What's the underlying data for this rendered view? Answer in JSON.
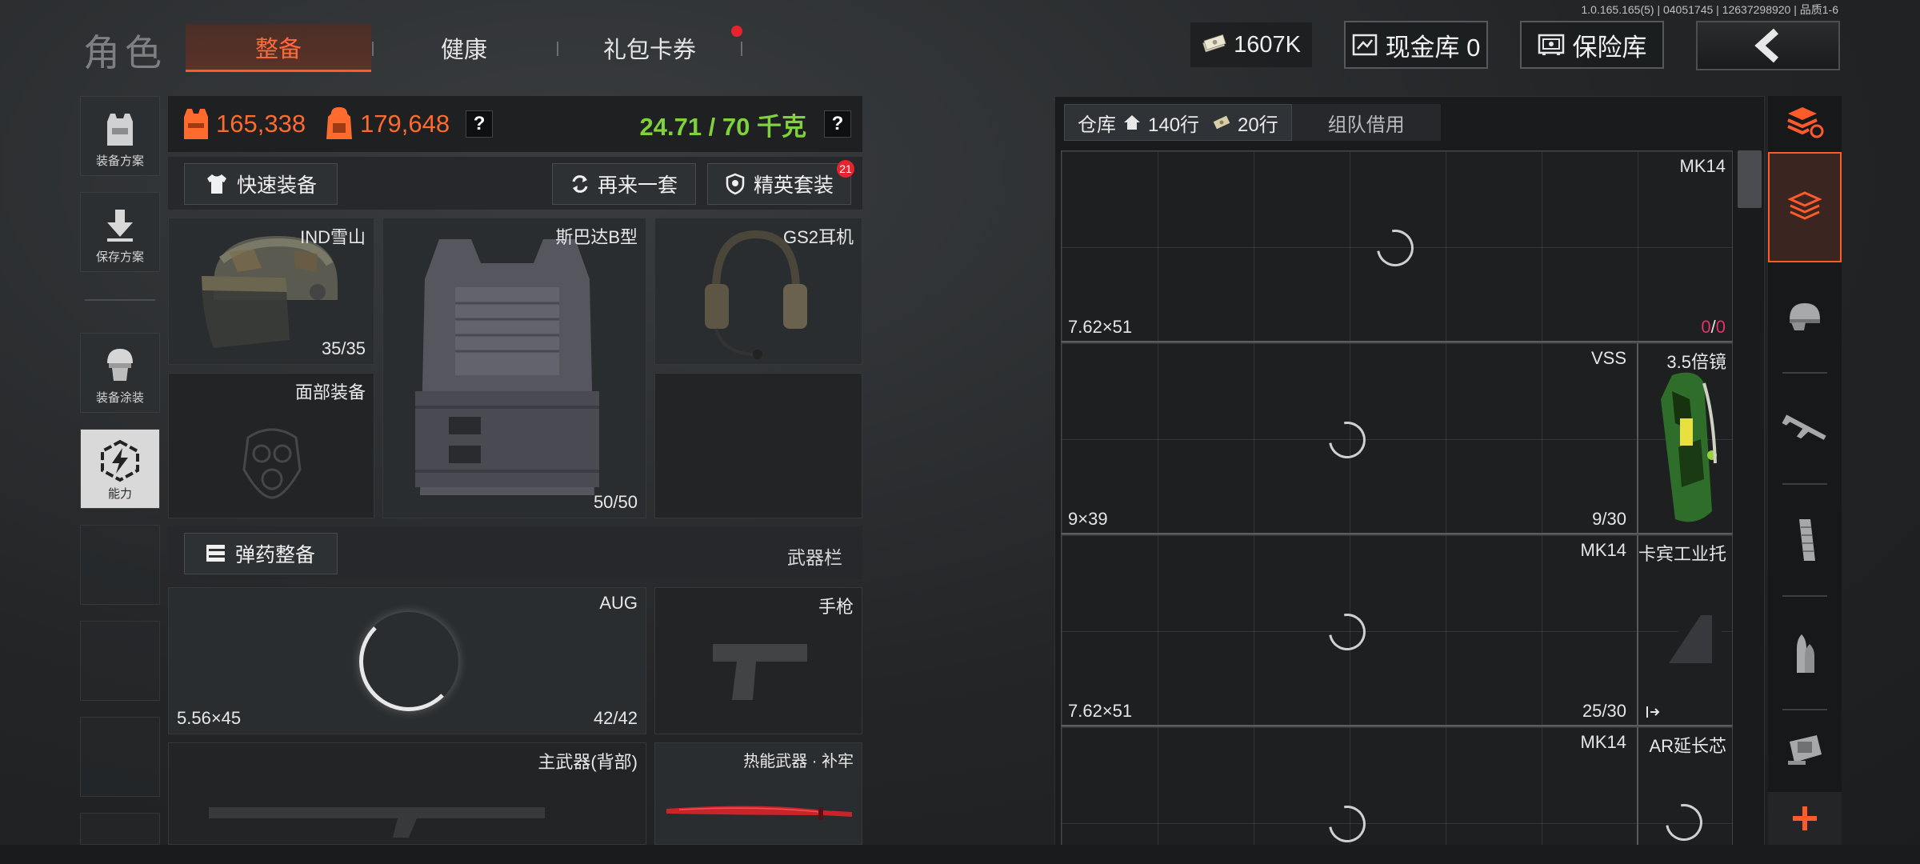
{
  "build_info": "1.0.165.165(5) | 04051745 | 12637298920 | 品质1-6",
  "page_title": "角色",
  "tabs": [
    {
      "label": "整备",
      "active": true
    },
    {
      "label": "健康",
      "active": false
    },
    {
      "label": "礼包卡券",
      "active": false,
      "has_notification": true
    }
  ],
  "currency": {
    "icon": "cash-stack-icon",
    "amount": "1607K"
  },
  "cash_vault": {
    "label": "现金库 0",
    "icon": "vault-card-icon"
  },
  "insured_vault": {
    "label": "保险库",
    "icon": "safe-icon"
  },
  "back": {
    "icon": "chevron-left-icon"
  },
  "sidebar": {
    "items": [
      {
        "label": "装备方案",
        "icon": "vest-icon"
      },
      {
        "label": "保存方案",
        "icon": "download-arrow-icon"
      },
      {
        "label": "装备涂装",
        "icon": "soldier-helmet-icon"
      },
      {
        "label": "能力",
        "icon": "lightning-hex-icon"
      }
    ]
  },
  "stats": {
    "vest_value": "165,338",
    "backpack_value": "179,648",
    "weight": "24.71 / 70 千克",
    "help": "?"
  },
  "actions": {
    "quick_equip": "快速装备",
    "again": "再来一套",
    "elite": "精英套装",
    "elite_badge": "21",
    "ammo": "弹药整备",
    "weapon_bar": "武器栏"
  },
  "slots": {
    "helmet": {
      "name": "IND雪山",
      "durability": "35/35"
    },
    "armor": {
      "name": "斯巴达B型",
      "durability": "50/50"
    },
    "headset": {
      "name": "GS2耳机"
    },
    "face": {
      "name": "面部装备"
    },
    "primary": {
      "name": "AUG",
      "caliber": "5.56×45",
      "ammo": "42/42"
    },
    "pistol": {
      "name": "手枪"
    },
    "back_weapon": {
      "name": "主武器(背部)"
    },
    "melee": {
      "name": "热能武器 · 补牢"
    }
  },
  "warehouse": {
    "tab_label": "仓库",
    "rows_home": "140行",
    "rows_ticket": "20行",
    "team_tab": "组队借用",
    "items": [
      {
        "name": "MK14",
        "caliber": "7.62×51",
        "ammo_current": "0",
        "ammo_sep": "/",
        "ammo_max": "0",
        "attachment": ""
      },
      {
        "name": "VSS",
        "caliber": "9×39",
        "ammo": "9/30",
        "attachment": "3.5倍镜"
      },
      {
        "name": "MK14",
        "caliber": "7.62×51",
        "ammo": "25/30",
        "attachment": "卡宾工业托"
      },
      {
        "name": "MK14",
        "caliber": "",
        "ammo": "",
        "attachment": "AR延长芯"
      }
    ]
  },
  "filters": [
    {
      "icon": "stack-refresh-icon"
    },
    {
      "icon": "all-items-icon",
      "active": true
    },
    {
      "icon": "helmet-filter-icon"
    },
    {
      "icon": "rifle-filter-icon"
    },
    {
      "icon": "magazine-filter-icon"
    },
    {
      "icon": "bullet-filter-icon"
    },
    {
      "icon": "sight-filter-icon"
    },
    {
      "icon": "plus-icon"
    }
  ],
  "colors": {
    "accent": "#ff5a2a",
    "weight_green": "#7fd23a",
    "value_orange": "#ff6a2e",
    "zero_red": "#e8306a"
  }
}
